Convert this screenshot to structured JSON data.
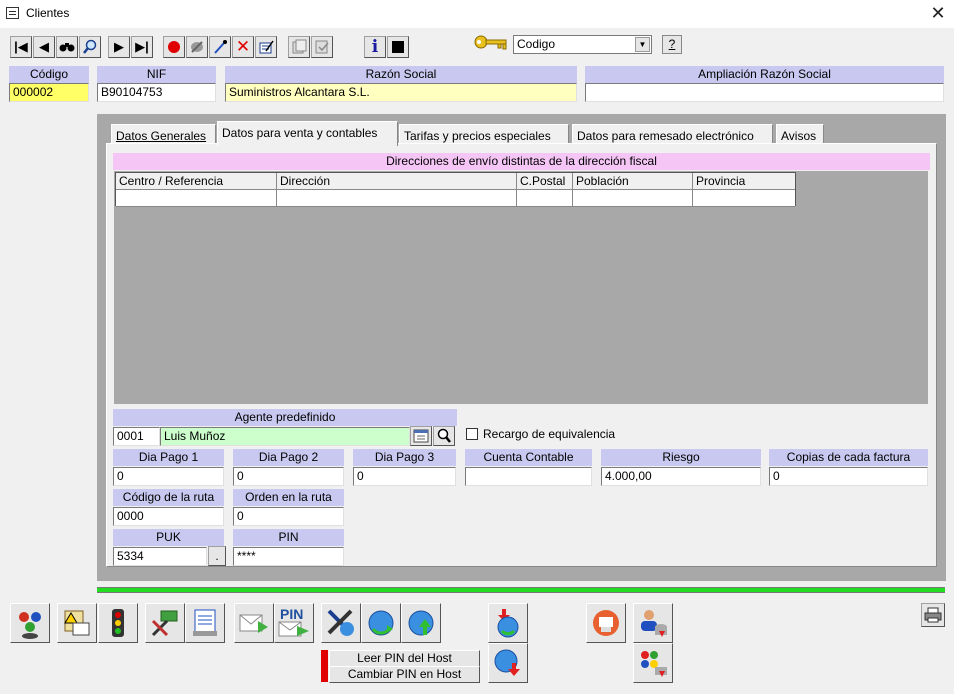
{
  "window": {
    "title": "Clientes"
  },
  "toolbar": {
    "order_label": "Codigo",
    "help_label": "?",
    "icons": [
      "first-icon",
      "prev-icon",
      "binoculars-icon",
      "zoom-icon",
      "next-icon",
      "last-icon",
      "record-icon",
      "cancel-edit-icon",
      "dropper-icon",
      "delete-icon",
      "edit-icon",
      "copy-icon",
      "paste-icon",
      "info-icon",
      "stop-icon",
      "key-icon"
    ]
  },
  "header": {
    "codigo_label": "Código",
    "codigo_value": "000002",
    "nif_label": "NIF",
    "nif_value": "B90104753",
    "razon_label": "Razón Social",
    "razon_value": "Suministros Alcantara S.L.",
    "ampliacion_label": "Ampliación Razón Social",
    "ampliacion_value": ""
  },
  "tabs": [
    {
      "label": "Datos Generales",
      "active": false
    },
    {
      "label": "Datos para venta y contables",
      "active": true
    },
    {
      "label": "Tarifas y precios especiales",
      "active": false
    },
    {
      "label": "Datos para remesado electrónico",
      "active": false
    },
    {
      "label": "Avisos",
      "active": false
    }
  ],
  "direcciones": {
    "title": "Direcciones de envío distintas de la dirección fiscal",
    "columns": [
      "Centro / Referencia",
      "Dirección",
      "C.Postal",
      "Población",
      "Provincia"
    ],
    "rows": [
      [
        "",
        "",
        "",
        "",
        ""
      ]
    ]
  },
  "agente": {
    "label": "Agente predefinido",
    "code": "0001",
    "name": "Luis Muñoz"
  },
  "recargo": {
    "label": "Recargo de equivalencia",
    "checked": false
  },
  "fields": {
    "dia1_label": "Dia Pago 1",
    "dia1_value": "0",
    "dia2_label": "Dia Pago 2",
    "dia2_value": "0",
    "dia3_label": "Dia Pago 3",
    "dia3_value": "0",
    "cuenta_label": "Cuenta Contable",
    "cuenta_value": "",
    "riesgo_label": "Riesgo",
    "riesgo_value": "4.000,00",
    "copias_label": "Copias de cada factura",
    "copias_value": "0",
    "ruta_label": "Código de la ruta",
    "ruta_value": "0000",
    "orden_label": "Orden en la ruta",
    "orden_value": "0",
    "puk_label": "PUK",
    "puk_value": "5334",
    "puk_btn": ".",
    "pin_label": "PIN",
    "pin_value": "****"
  },
  "bottom": {
    "leer_pin": "Leer PIN del Host",
    "cambiar_pin": "Cambiar PIN en Host",
    "pin_icon_text": "PIN"
  },
  "colors": {
    "label_bg": "#c8c8f0",
    "pink_header": "#f5c6f5",
    "yellow_field": "#ffff66",
    "green_field": "#ccffcc",
    "progress": "#22dd22"
  }
}
